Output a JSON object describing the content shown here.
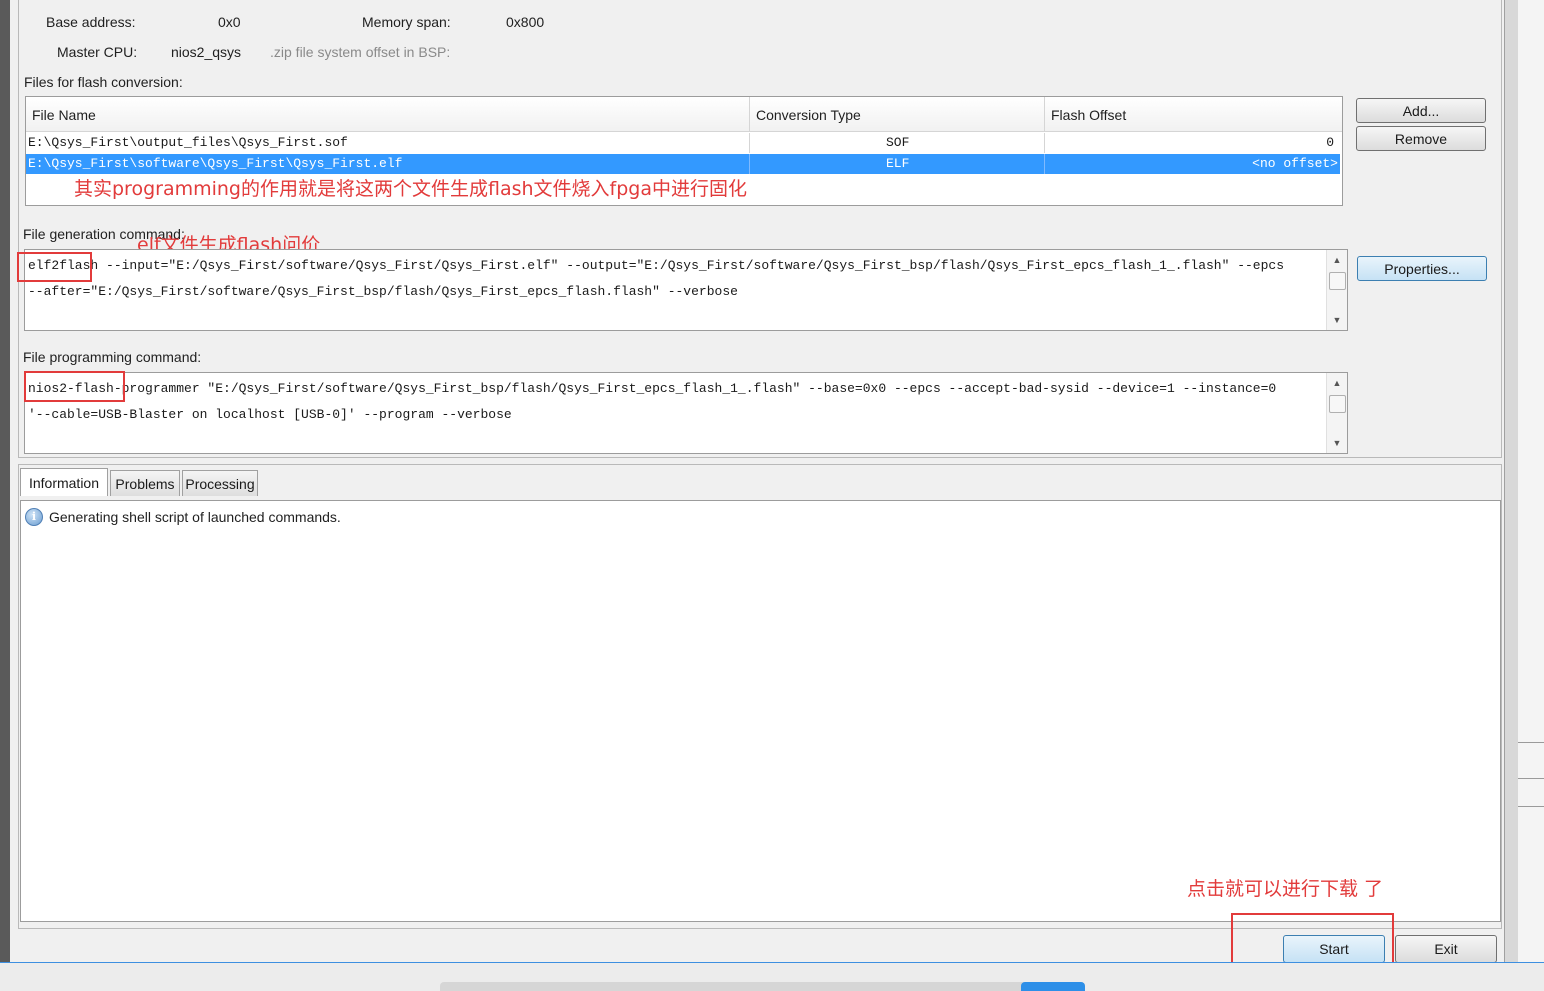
{
  "bsp": {
    "base_address_label": "Base address:",
    "base_address_value": "0x0",
    "memory_span_label": "Memory span:",
    "memory_span_value": "0x800",
    "master_cpu_label": "Master CPU:",
    "master_cpu_value": "nios2_qsys",
    "zip_offset_label": ".zip file system offset in BSP:"
  },
  "files": {
    "section_label": "Files for flash conversion:",
    "columns": [
      "File Name",
      "Conversion Type",
      "Flash Offset"
    ],
    "rows": [
      {
        "name": "E:\\Qsys_First\\output_files\\Qsys_First.sof",
        "type": "SOF",
        "offset": "0"
      },
      {
        "name": "E:\\Qsys_First\\software\\Qsys_First\\Qsys_First.elf",
        "type": "ELF",
        "offset": "<no offset>"
      }
    ],
    "add_button": "Add...",
    "remove_button": "Remove"
  },
  "generation": {
    "label": "File generation command:",
    "line1": "elf2flash --input=\"E:/Qsys_First/software/Qsys_First/Qsys_First.elf\" --output=\"E:/Qsys_First/software/Qsys_First_bsp/flash/Qsys_First_epcs_flash_1_.flash\" --epcs",
    "line2": "--after=\"E:/Qsys_First/software/Qsys_First_bsp/flash/Qsys_First_epcs_flash.flash\" --verbose",
    "properties_button": "Properties..."
  },
  "programming": {
    "label": "File programming command:",
    "line1": "nios2-flash-programmer \"E:/Qsys_First/software/Qsys_First_bsp/flash/Qsys_First_epcs_flash_1_.flash\" --base=0x0 --epcs --accept-bad-sysid --device=1 --instance=0",
    "line2": "'--cable=USB-Blaster on localhost [USB-0]' --program --verbose"
  },
  "tabs": [
    "Information",
    "Problems",
    "Processing"
  ],
  "messages": [
    {
      "icon": "info-icon",
      "text": "Generating shell script of launched commands."
    }
  ],
  "footer": {
    "start_button": "Start",
    "exit_button": "Exit"
  },
  "annotations": {
    "note_files": "其实programming的作用就是将这两个文件生成flash文件烧入fpga中进行固化",
    "note_elf": "elf文件生成flash问价",
    "note_start": "点击就可以进行下载 了"
  },
  "colors": {
    "selection": "#3399ff",
    "annotation": "#e23b3b",
    "window_bg": "#f0f0f0"
  }
}
